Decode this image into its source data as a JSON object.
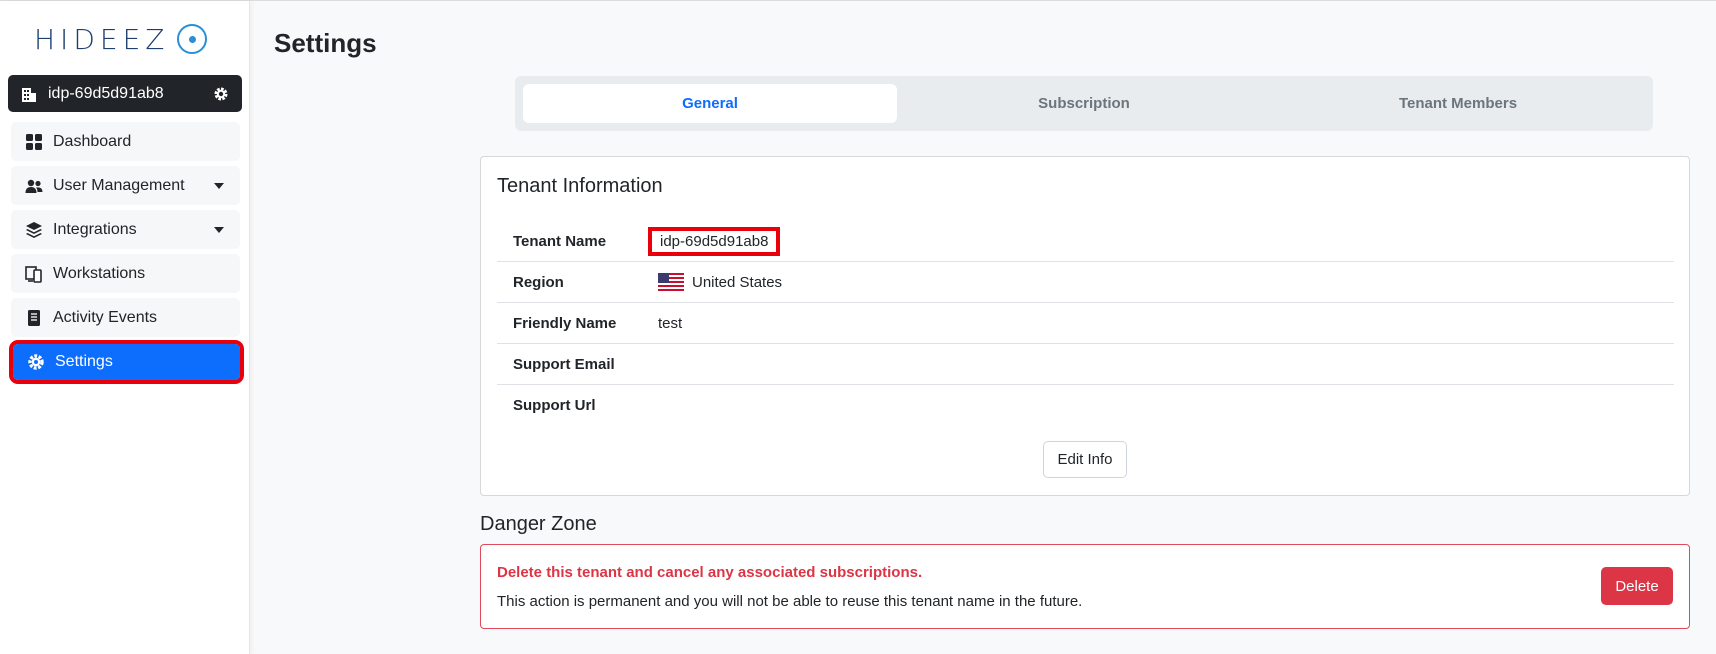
{
  "brand": {
    "logo_text": "HIDEEZ"
  },
  "tenant_selector": {
    "name": "idp-69d5d91ab8"
  },
  "sidebar": {
    "items": [
      {
        "label": "Dashboard",
        "icon": "dashboard-grid-icon"
      },
      {
        "label": "User Management",
        "icon": "users-icon",
        "has_submenu": true
      },
      {
        "label": "Integrations",
        "icon": "layers-icon",
        "has_submenu": true
      },
      {
        "label": "Workstations",
        "icon": "workstations-icon"
      },
      {
        "label": "Activity Events",
        "icon": "document-icon"
      },
      {
        "label": "Settings",
        "icon": "gear-icon",
        "active": true
      }
    ]
  },
  "page": {
    "title": "Settings"
  },
  "tabs": [
    {
      "label": "General",
      "active": true
    },
    {
      "label": "Subscription"
    },
    {
      "label": "Tenant Members"
    }
  ],
  "tenant_info": {
    "title": "Tenant Information",
    "rows": [
      {
        "label": "Tenant Name",
        "value": "idp-69d5d91ab8"
      },
      {
        "label": "Region",
        "value": "United States",
        "icon": "us-flag-icon"
      },
      {
        "label": "Friendly Name",
        "value": "test"
      },
      {
        "label": "Support Email",
        "value": ""
      },
      {
        "label": "Support Url",
        "value": ""
      }
    ],
    "edit_button": "Edit Info"
  },
  "danger_zone": {
    "title": "Danger Zone",
    "heading": "Delete this tenant and cancel any associated subscriptions.",
    "text": "This action is permanent and you will not be able to reuse this tenant name in the future.",
    "delete_button": "Delete"
  },
  "colors": {
    "primary": "#0d6efd",
    "danger": "#dc3545",
    "highlight_annotation": "#e8000b",
    "dark": "#212529"
  }
}
